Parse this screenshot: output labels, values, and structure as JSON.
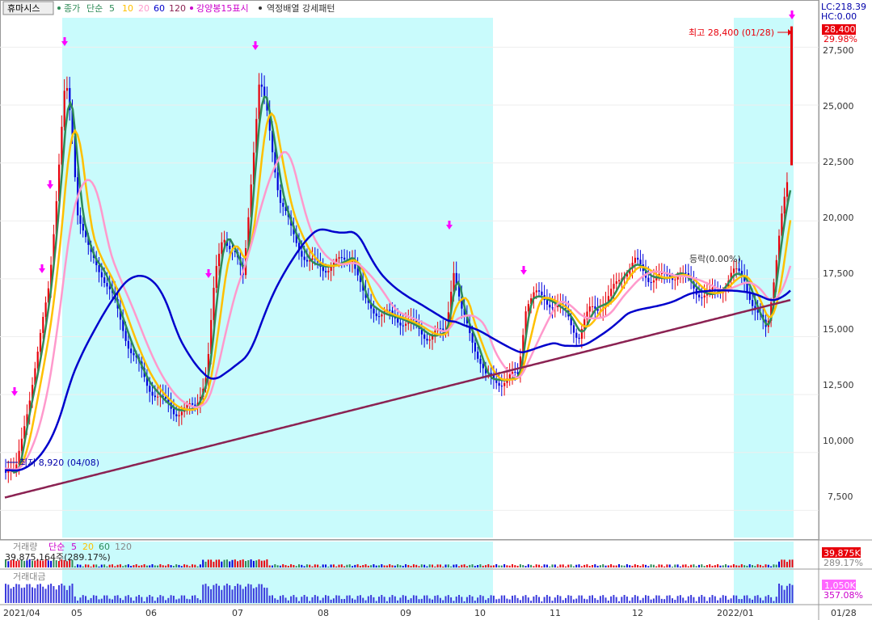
{
  "stock_name": "휴마시스",
  "legend": {
    "price_label": "종가",
    "ma_type": "단순",
    "periods": [
      "5",
      "10",
      "20",
      "60",
      "120"
    ],
    "period_colors": [
      "#2e8b57",
      "#ffc000",
      "#ff99cc",
      "#0000cc",
      "#8b2252"
    ],
    "signal_label": "강양봉15표시",
    "pattern_label": "역정배열 강세패턴"
  },
  "top_right": {
    "lc": "LC:218.39",
    "hc": "HC:0.00"
  },
  "price_axis": {
    "ticks": [
      "27,500",
      "25,000",
      "22,500",
      "20,000",
      "17,500",
      "15,000",
      "12,500",
      "10,000",
      "7,500"
    ],
    "current_price": "28,400",
    "current_change": "29.98%"
  },
  "annotations": {
    "high": "최고 28,400 (01/28)",
    "low": "최저 8,920 (04/08)",
    "middle": "등락(0.00%)"
  },
  "volume_panel": {
    "title": "거래량",
    "ma_type": "단순",
    "periods": [
      "5",
      "20",
      "60",
      "120"
    ],
    "value_text": "39,875,164주(289.17%)",
    "axis_value": "39,875K",
    "axis_pct": "289.17%"
  },
  "amount_panel": {
    "title": "거래대금",
    "axis_value": "1,050K",
    "axis_pct": "357.08%"
  },
  "date_axis": {
    "labels": [
      "2021/04",
      "05",
      "06",
      "07",
      "08",
      "09",
      "10",
      "11",
      "12",
      "2022/01",
      "01/28"
    ]
  },
  "colors": {
    "up": "#e8000b",
    "down": "#0000dd",
    "shade": "#c9fbfc",
    "marker": "#ff00ff"
  },
  "chart_data": {
    "type": "candlestick",
    "title": "휴마시스",
    "x_range": [
      "2021/04",
      "2022/01/28"
    ],
    "ylim": [
      6500,
      28700
    ],
    "ma_periods": [
      5,
      10,
      20,
      60,
      120
    ],
    "key_points": [
      {
        "label": "최저",
        "date": "04/08",
        "price": 8920
      },
      {
        "label": "최고",
        "date": "01/28",
        "price": 28400
      }
    ],
    "shaded_periods": [
      [
        "2021/05",
        "2021/10"
      ],
      [
        "2022/01",
        "2022/01/28"
      ]
    ]
  }
}
